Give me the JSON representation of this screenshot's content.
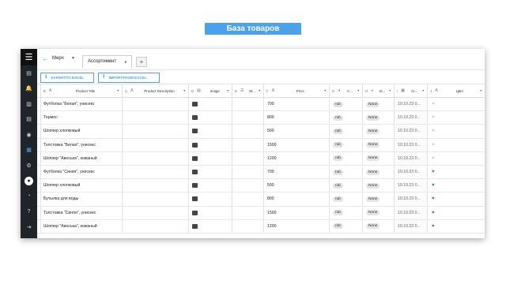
{
  "banner": {
    "title": "База товаров"
  },
  "sidebar": {
    "menu_icon": "hamburger-icon",
    "items": [
      {
        "icon": "document-icon",
        "glyph": "▤"
      },
      {
        "icon": "bell-icon",
        "glyph": "🔔"
      },
      {
        "icon": "chart-icon",
        "glyph": "▥"
      },
      {
        "icon": "file-icon",
        "glyph": "▤"
      },
      {
        "icon": "chat-icon",
        "glyph": "◉"
      },
      {
        "icon": "table-icon",
        "glyph": "▦"
      },
      {
        "icon": "settings-icon",
        "glyph": "⚙"
      },
      {
        "icon": "user-icon",
        "glyph": "●"
      },
      {
        "icon": "dashboard-icon",
        "glyph": "◔"
      },
      {
        "icon": "help-icon",
        "glyph": "?"
      },
      {
        "icon": "logout-icon",
        "glyph": "⇥"
      }
    ]
  },
  "header": {
    "back": "←",
    "project": "Мерч",
    "project_caret": "▼",
    "tab": "Ассортимент",
    "tab_caret": "▼",
    "add_tab": "+"
  },
  "toolbar": {
    "export_label": "EXPORTTO EXCEL",
    "import_label": "IMPORTFROM EXCEL"
  },
  "columns": [
    {
      "letter": "B",
      "title": "Product Title",
      "icon": "text-icon"
    },
    {
      "letter": "C",
      "title": "Product Description",
      "icon": "text-icon"
    },
    {
      "letter": "D",
      "title": "Image",
      "icon": "file-icon"
    },
    {
      "letter": "E",
      "title": "St...",
      "icon": "list-icon"
    },
    {
      "letter": "F",
      "title": "Price",
      "icon": "text-icon"
    },
    {
      "letter": "G",
      "title": "C...",
      "icon": "check-icon"
    },
    {
      "letter": "H",
      "title": "Si...",
      "icon": "check-icon"
    },
    {
      "letter": "I",
      "title": "Cr...",
      "icon": "calendar-icon"
    },
    {
      "letter": "J",
      "title": "Цвет",
      "icon": "text-icon"
    }
  ],
  "rows": [
    {
      "title": "Футболка \"Белая\", унисекс",
      "price": "700",
      "currency": "rub",
      "size": "None",
      "date": "10.10.23 0...",
      "color": "white"
    },
    {
      "title": "Термос",
      "price": "800",
      "currency": "rub",
      "size": "None",
      "date": "10.10.23 0...",
      "color": "white"
    },
    {
      "title": "Шоппер хлопковый",
      "price": "500",
      "currency": "rub",
      "size": "None",
      "date": "10.10.23 0...",
      "color": "white"
    },
    {
      "title": "Толстовка \"Белая\", унисекс",
      "price": "1500",
      "currency": "rub",
      "size": "None",
      "date": "10.10.23 0...",
      "color": "white"
    },
    {
      "title": "Шоппер \"Авоська\", кожаный",
      "price": "1200",
      "currency": "rub",
      "size": "None",
      "date": "10.10.23 0...",
      "color": "white"
    },
    {
      "title": "Футболка \"Синяя\", унисекс",
      "price": "700",
      "currency": "rub",
      "size": "None",
      "date": "10.10.23 0...",
      "color": "blue"
    },
    {
      "title": "Шоппер хлопковый",
      "price": "500",
      "currency": "rub",
      "size": "None",
      "date": "10.10.23 0...",
      "color": "blue"
    },
    {
      "title": "Бутылка для воды",
      "price": "800",
      "currency": "rub",
      "size": "None",
      "date": "10.10.23 0...",
      "color": "blue"
    },
    {
      "title": "Толстовка \"Синяя\", унисекс",
      "price": "1500",
      "currency": "rub",
      "size": "None",
      "date": "10.10.23 0...",
      "color": "blue"
    },
    {
      "title": "Шоппер \"Авоська\", кожаный",
      "price": "1200",
      "currency": "rub",
      "size": "None",
      "date": "10.10.23 0...",
      "color": "blue"
    }
  ],
  "colors": {
    "accent": "#4aa3ea",
    "rail": "#1f2429",
    "heart_blue": "#2e7cd6",
    "heart_white": "#cccccc"
  }
}
